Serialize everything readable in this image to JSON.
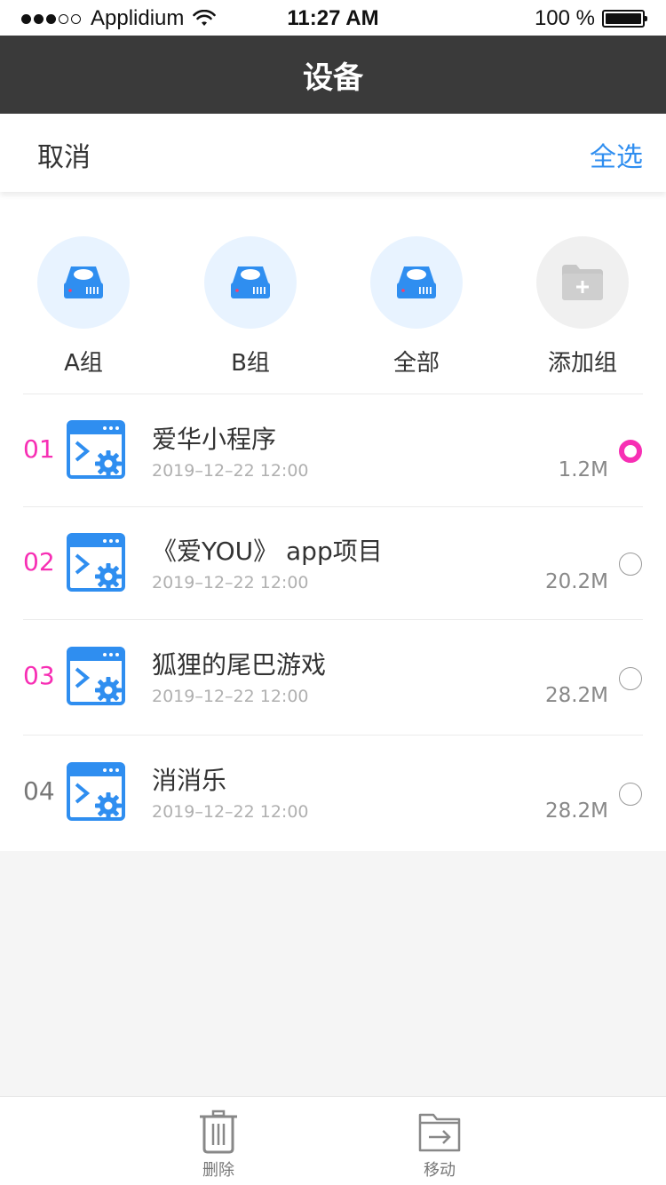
{
  "status_bar": {
    "carrier": "Applidium",
    "time": "11:27 AM",
    "battery": "100 %"
  },
  "nav": {
    "title": "设备"
  },
  "actions": {
    "cancel": "取消",
    "select_all": "全选"
  },
  "groups": [
    {
      "label": "A组",
      "icon": "drive-icon"
    },
    {
      "label": "B组",
      "icon": "drive-icon"
    },
    {
      "label": "全部",
      "icon": "drive-icon"
    },
    {
      "label": "添加组",
      "icon": "add-folder-icon"
    }
  ],
  "items": [
    {
      "index": "01",
      "name": "爱华小程序",
      "date": "2019–12–22 12:00",
      "size": "1.2M",
      "selected": true
    },
    {
      "index": "02",
      "name": "《爱YOU》 app项目",
      "date": "2019–12–22 12:00",
      "size": "20.2M",
      "selected": false
    },
    {
      "index": "03",
      "name": "狐狸的尾巴游戏",
      "date": "2019–12–22 12:00",
      "size": "28.2M",
      "selected": false
    },
    {
      "index": "04",
      "name": "消消乐",
      "date": "2019–12–22 12:00",
      "size": "28.2M",
      "selected": false
    }
  ],
  "toolbar": {
    "delete": "删除",
    "move": "移动"
  },
  "colors": {
    "accent_blue": "#2f8ef0",
    "accent_pink": "#f72fb4",
    "nav_bg": "#3a3a3a",
    "index_highlight": "#f72fb4",
    "index_default": "#777777"
  }
}
